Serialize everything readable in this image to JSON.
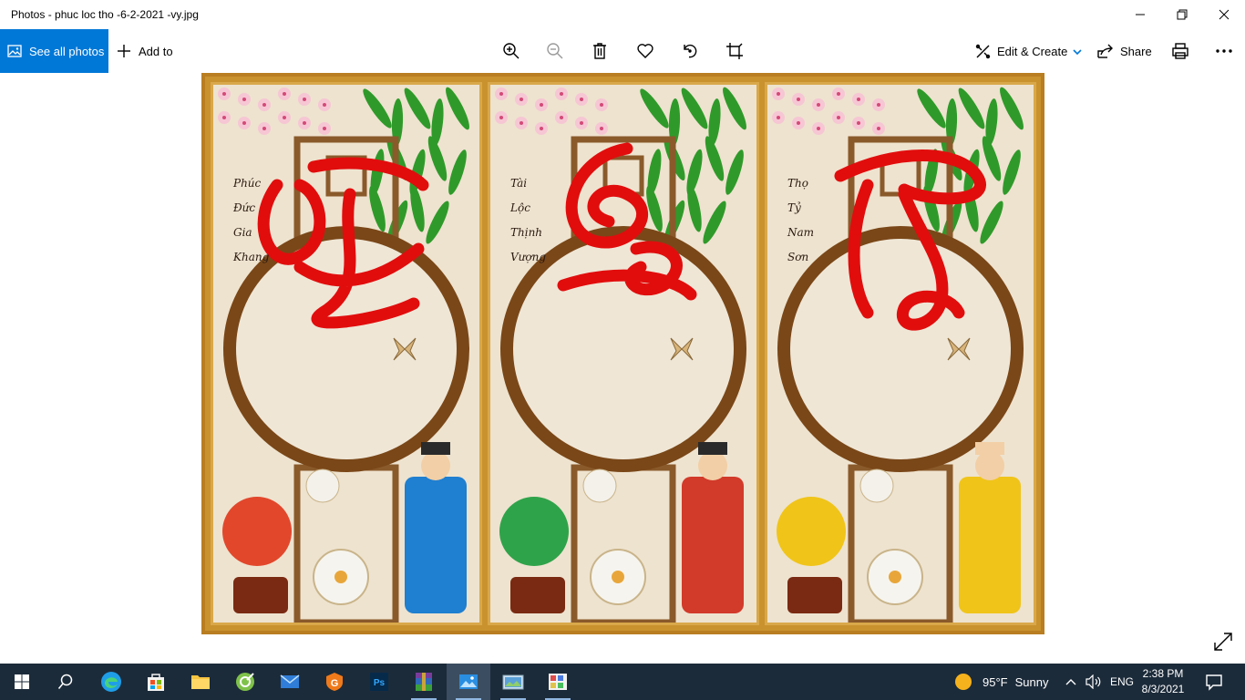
{
  "window": {
    "title": "Photos - phuc loc tho -6-2-2021 -vy.jpg",
    "controls": [
      "minimize-icon",
      "restore-icon",
      "close-icon"
    ]
  },
  "toolbar": {
    "see_all_label": "See all photos",
    "add_to_label": "Add to",
    "center_icons": [
      "zoom-in-icon",
      "zoom-out-icon",
      "delete-icon",
      "favorite-icon",
      "rotate-icon",
      "crop-icon"
    ],
    "edit_create_label": "Edit & Create",
    "share_label": "Share",
    "accent_color": "#0078d7"
  },
  "image": {
    "panels": [
      {
        "caption_lines": [
          "Phúc",
          "Đức",
          "Gia",
          "Khang"
        ],
        "character": "Phúc"
      },
      {
        "caption_lines": [
          "Tài",
          "Lộc",
          "Thịnh",
          "Vượng"
        ],
        "character": "Lộc"
      },
      {
        "caption_lines": [
          "Thọ",
          "Tỷ",
          "Nam",
          "Sơn"
        ],
        "character": "Thọ"
      }
    ],
    "calligraphy_color": "#e10d0d",
    "background_color": "#eee3cf",
    "frame_color": "#c9922e"
  },
  "taskbar": {
    "apps": [
      "windows-start-icon",
      "search-icon",
      "edge-icon",
      "store-icon",
      "file-explorer-icon",
      "greenshot-icon",
      "mail-icon",
      "glary-icon",
      "photoshop-icon",
      "winrar-icon",
      "photos-icon",
      "image-viewer-icon",
      "paint-icon"
    ],
    "weather": {
      "temperature": "95°F",
      "condition": "Sunny"
    },
    "language": "ENG",
    "time": "2:38 PM",
    "date": "8/3/2021",
    "background_color": "#1c2b3a"
  }
}
